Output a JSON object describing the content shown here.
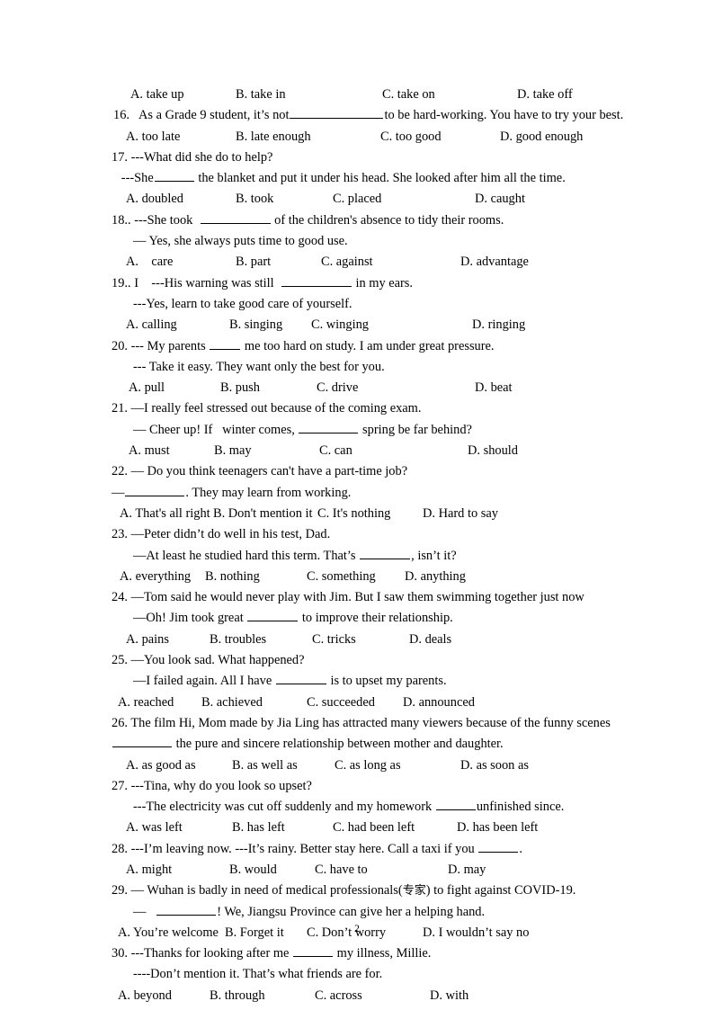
{
  "document": {
    "page_number": "2",
    "text_color": "#000000",
    "background_color": "#ffffff"
  },
  "q15_options": {
    "a": "A. take up",
    "b": "B. take in",
    "c": "C. take on",
    "d": "D. take off"
  },
  "items": [
    {
      "number": "16.",
      "stem_pre": "   As a Grade 9 student, it’s not",
      "stem_post": "to be hard-working. You have to try your best.",
      "options": {
        "a": "A. too late",
        "b": "B. late enough",
        "c": "C. too good",
        "d": "D. good enough"
      }
    },
    {
      "number": "17.",
      "line1": " ---What did she do to help?",
      "line2_pre": "   ---She",
      "line2_post": " the blanket and put it under his head. She looked after him all the time.",
      "options": {
        "a": "A. doubled",
        "b": "B. took",
        "c": "C. placed",
        "d": "D. caught"
      }
    },
    {
      "number": "18..",
      "line1_pre": " ---She took  ",
      "line1_post": " of the children's absence to tidy their rooms.",
      "line2": "— Yes, she always puts time to good use.",
      "options": {
        "a": "A.    care",
        "b": "B. part",
        "c": "C. against",
        "d": "D. advantage"
      }
    },
    {
      "number": "19..",
      "line1_pre": " I    ---His warning was still  ",
      "line1_post": " in my ears.",
      "line2": "---Yes, learn to take good care of yourself.",
      "options": {
        "a": "A. calling",
        "b": "B. singing",
        "c": "C. winging",
        "d": "D. ringing"
      }
    },
    {
      "number": "20.",
      "line1_pre": " --- My parents ",
      "line1_post": " me too hard on study. I am under great pressure.",
      "line2": "--- Take it easy. They want only the best for you.",
      "options": {
        "a": "A. pull",
        "b": "B. push",
        "c": "C. drive",
        "d": "D. beat"
      }
    },
    {
      "number": "21.",
      "line1": " —I really feel stressed out because of the coming exam.",
      "line2_pre": "— Cheer up! If   winter comes, ",
      "line2_post": " spring be far behind?",
      "options": {
        "a": "A. must",
        "b": "B. may",
        "c": "C. can",
        "d": "D. should"
      }
    },
    {
      "number": "22.",
      "line1": " — Do you think teenagers can't have a part-time job?",
      "line2_pre": "—",
      "line2_post": ". They may learn from working.",
      "options": {
        "a": "A. That's all right",
        "b": "B. Don't mention it",
        "c": "C. It's nothing",
        "d": "D. Hard to say"
      }
    },
    {
      "number": "23.",
      "line1": " —Peter didn’t do well in his test, Dad.",
      "line2_pre": "—At least he studied hard this term. That’s ",
      "line2_post": ", isn’t it?",
      "options": {
        "a": "A. everything",
        "b": "B. nothing",
        "c": "C. something",
        "d": "D. anything"
      }
    },
    {
      "number": "24.",
      "line1": " —Tom said he would never play with Jim. But I saw them swimming together just now",
      "line2_pre": "—Oh! Jim took great ",
      "line2_post": " to improve their relationship.",
      "options": {
        "a": "A. pains",
        "b": "B. troubles",
        "c": "C. tricks",
        "d": "D. deals"
      }
    },
    {
      "number": "25.",
      "line1": " —You look sad. What happened?",
      "line2_pre": "—I failed again. All I have ",
      "line2_post": " is to upset my parents.",
      "options": {
        "a": "A. reached",
        "b": "B. achieved",
        "c": "C. succeeded",
        "d": "D. announced"
      }
    },
    {
      "number": "26.",
      "line1": " The film Hi, Mom made by Jia Ling has attracted many viewers because of the funny scenes",
      "line2_post": " the pure and sincere relationship between mother and daughter.",
      "options": {
        "a": "A. as good as",
        "b": "B. as well as",
        "c": "C. as long as",
        "d": "D. as soon as"
      }
    },
    {
      "number": "27.",
      "line1": " ---Tina, why do you look so upset?",
      "line2_pre": "---The electricity was cut off suddenly and my homework ",
      "line2_post": "unfinished since.",
      "options": {
        "a": "A. was left",
        "b": "B. has left",
        "c": "C. had been left",
        "d": "D. has been left"
      }
    },
    {
      "number": "28.",
      "line1_pre": " ---I’m leaving now. ---It’s rainy. Better stay here. Call a taxi if you ",
      "line1_post": ".",
      "options": {
        "a": "A. might",
        "b": "B. would",
        "c": "C. have to",
        "d": "D. may"
      }
    },
    {
      "number": "29.",
      "line1_pre": " — Wuhan is badly in need of medical professionals(",
      "line1_cjk": "专家",
      "line1_post": ") to fight against COVID-19.",
      "line2_pre": "—   ",
      "line2_post": "! We, Jiangsu Province can give her a helping hand.",
      "options": {
        "a": "A. You’re welcome",
        "b": "B. Forget it",
        "c": "C. Don’t worry",
        "d": "D. I wouldn’t say no"
      }
    },
    {
      "number": "30.",
      "line1_pre": " ---Thanks for looking after me ",
      "line1_post": " my illness, Millie.",
      "line2": "----Don’t mention it. That’s what friends are for.",
      "options": {
        "a": "A. beyond",
        "b": "B. through",
        "c": "C. across",
        "d": "D. with"
      }
    }
  ]
}
